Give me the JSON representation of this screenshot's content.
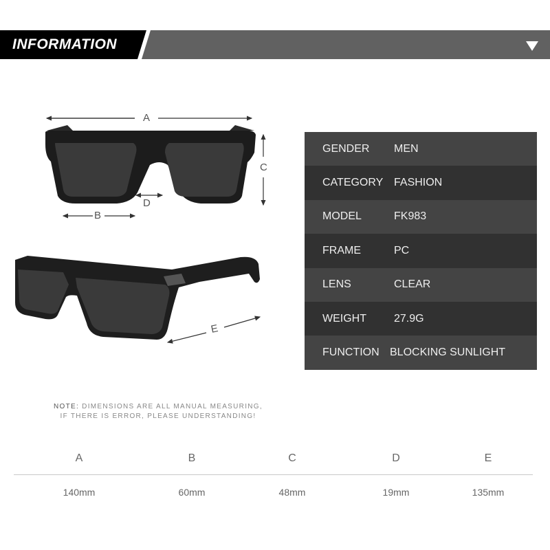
{
  "header": {
    "title": "INFORMATION",
    "dropdown_icon": "triangle-down-icon",
    "colors": {
      "dark": "#000000",
      "band": "#616161"
    }
  },
  "diagram": {
    "labels": {
      "a": "A",
      "b": "B",
      "c": "C",
      "d": "D",
      "e": "E"
    }
  },
  "spec_table": {
    "rows": [
      {
        "key": "GENDER",
        "value": "MEN"
      },
      {
        "key": "CATEGORY",
        "value": "FASHION"
      },
      {
        "key": "MODEL",
        "value": "FK983"
      },
      {
        "key": "FRAME",
        "value": "PC"
      },
      {
        "key": "LENS",
        "value": "CLEAR"
      },
      {
        "key": "WEIGHT",
        "value": "27.9G"
      },
      {
        "key": "FUNCTION",
        "value": "BLOCKING SUNLIGHT"
      }
    ],
    "colors": {
      "odd": "#444444",
      "even": "#313131"
    }
  },
  "note": {
    "prefix": "NOTE:",
    "line1": " DIMENSIONS ARE ALL MANUAL MEASURING,",
    "line2": "IF THERE IS ERROR, PLEASE UNDERSTANDING!"
  },
  "dimensions": {
    "columns": [
      {
        "label": "A",
        "value": "140mm"
      },
      {
        "label": "B",
        "value": "60mm"
      },
      {
        "label": "C",
        "value": "48mm"
      },
      {
        "label": "D",
        "value": "19mm"
      },
      {
        "label": "E",
        "value": "135mm"
      }
    ]
  }
}
